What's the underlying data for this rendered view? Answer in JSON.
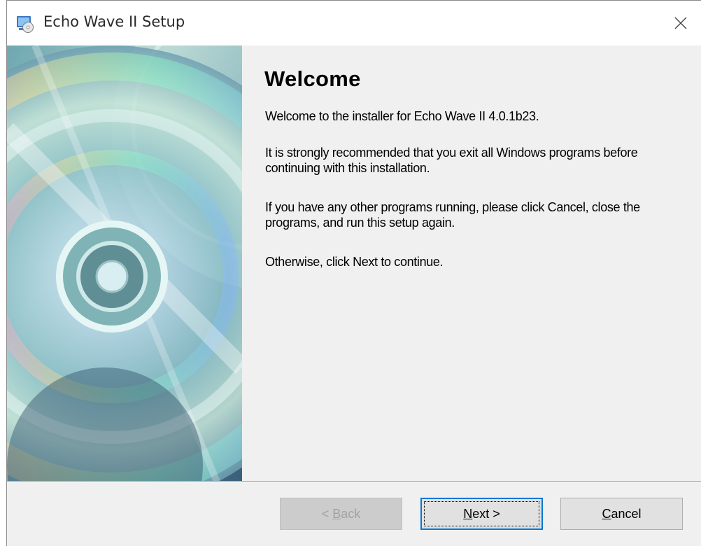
{
  "window": {
    "title": "Echo Wave II Setup",
    "icons": {
      "app": "setup-app-icon",
      "close": "close-icon"
    }
  },
  "banner": {
    "description_icon": "cd-disc-image"
  },
  "welcome": {
    "heading": "Welcome",
    "paragraphs": [
      "Welcome to the installer for Echo Wave II 4.0.1b23.",
      "It is strongly recommended that you exit all Windows programs before continuing with this installation.",
      "If you have any other programs running, please click Cancel, close the programs, and run this setup again.",
      "Otherwise, click Next to continue."
    ]
  },
  "buttons": {
    "back": {
      "pre": "< ",
      "key": "B",
      "post": "ack",
      "enabled": false
    },
    "next": {
      "key": "N",
      "post": "ext >",
      "enabled": true
    },
    "cancel": {
      "key": "C",
      "post": "ancel",
      "enabled": true
    }
  },
  "colors": {
    "focus_border": "#0078d7",
    "dialog_bg": "#f0f0f0"
  }
}
